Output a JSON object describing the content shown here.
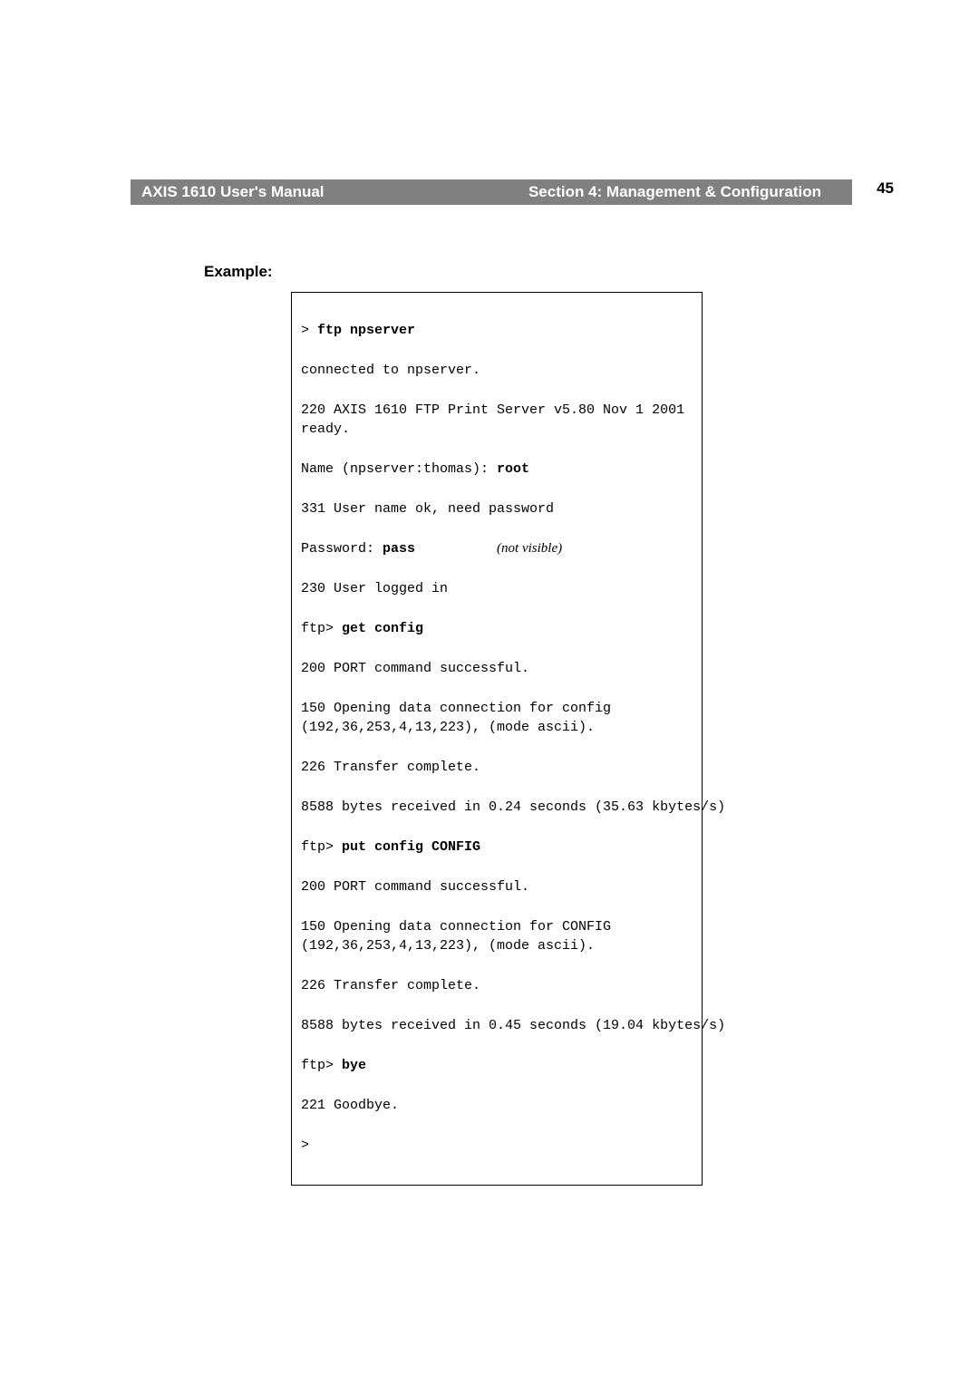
{
  "header": {
    "manual_title": "AXIS 1610 User's Manual",
    "section_title": "Section 4: Management & Configuration",
    "page_number": "45"
  },
  "example_label": "Example:",
  "terminal": {
    "l1_prompt": "> ",
    "l1_cmd": "ftp npserver",
    "l2": "connected to npserver.",
    "l3": "220 AXIS 1610 FTP Print Server v5.80 Nov 1 2001 ready.",
    "l4_pre": "Name (npserver:thomas): ",
    "l4_cmd": "root",
    "l5": "331 User name ok, need password",
    "l6_pre": "Password: ",
    "l6_cmd": "pass",
    "l6_note": "(not visible)",
    "l7": "230 User logged in",
    "l8_pre": "ftp> ",
    "l8_cmd": "get config",
    "l9": "200 PORT command successful.",
    "l10": "150 Opening data connection for config (192,36,253,4,13,223), (mode ascii).",
    "l11": "226 Transfer complete.",
    "l12": "8588 bytes received in 0.24 seconds (35.63 kbytes/s)",
    "l13_pre": "ftp> ",
    "l13_cmd": "put config CONFIG",
    "l14": "200 PORT command successful.",
    "l15": "150 Opening data connection for CONFIG (192,36,253,4,13,223), (mode ascii).",
    "l16": "226 Transfer complete.",
    "l17": "8588 bytes received in 0.45 seconds (19.04 kbytes/s)",
    "l18_pre": "ftp> ",
    "l18_cmd": "bye",
    "l19": "221 Goodbye.",
    "l20": ">"
  }
}
